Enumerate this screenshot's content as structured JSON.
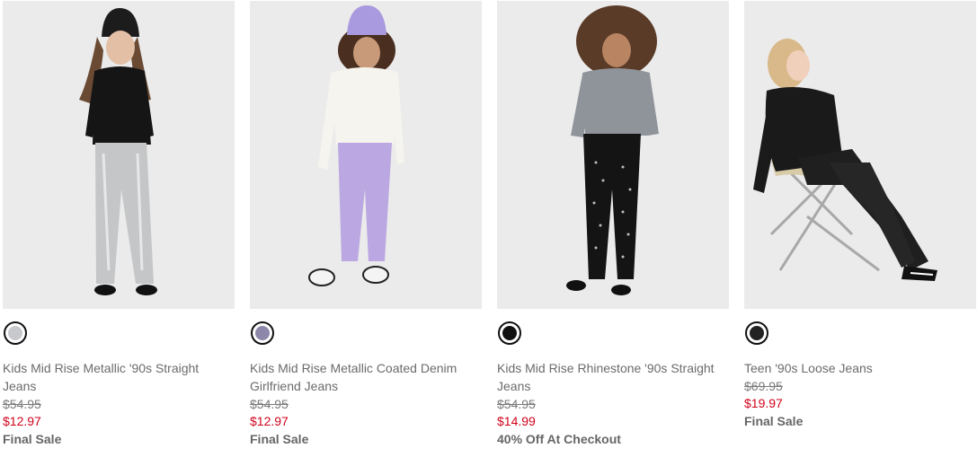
{
  "products": [
    {
      "name": "Kids Mid Rise Metallic '90s Straight Jeans",
      "original_price": "$54.95",
      "sale_price": "$12.97",
      "promo": "Final Sale",
      "swatch_color": "#c8c9cc"
    },
    {
      "name": "Kids Mid Rise Metallic Coated Denim Girlfriend Jeans",
      "original_price": "$54.95",
      "sale_price": "$12.97",
      "promo": "Final Sale",
      "swatch_color": "#8d87a9"
    },
    {
      "name": "Kids Mid Rise Rhinestone '90s Straight Jeans",
      "original_price": "$54.95",
      "sale_price": "$14.99",
      "promo": "40% Off At Checkout",
      "swatch_color": "#111111"
    },
    {
      "name": "Teen '90s Loose Jeans",
      "original_price": "$69.95",
      "sale_price": "$19.97",
      "promo": "Final Sale",
      "swatch_color": "#222222"
    }
  ]
}
